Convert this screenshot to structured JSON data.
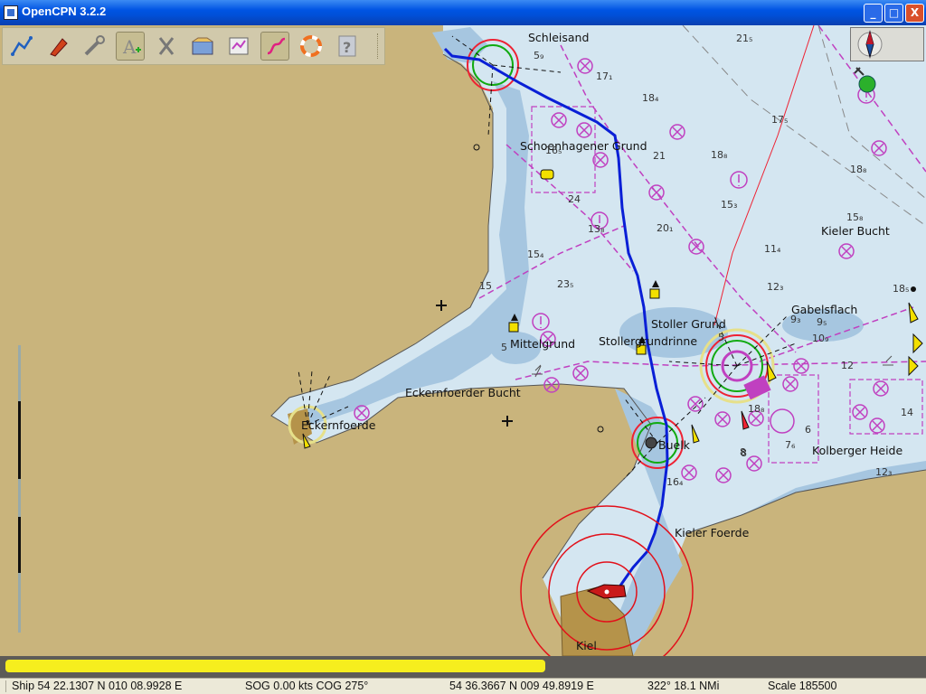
{
  "window": {
    "title": "OpenCPN 3.2.2",
    "min_label": "_",
    "max_label": "□",
    "close_label": "X"
  },
  "toolbar": {
    "buttons": [
      {
        "name": "route-icon",
        "tip": "Create Route"
      },
      {
        "name": "ownship-icon",
        "tip": "Auto Follow"
      },
      {
        "name": "settings-icon",
        "tip": "Toolbox"
      },
      {
        "name": "text-icon",
        "tip": "Show ENC Text"
      },
      {
        "name": "anchor-icon",
        "tip": "Anchor"
      },
      {
        "name": "tides-icon",
        "tip": "Tides"
      },
      {
        "name": "route-manager-icon",
        "tip": "Route Manager"
      },
      {
        "name": "track-icon",
        "tip": "Track"
      },
      {
        "name": "mob-icon",
        "tip": "Man Overboard"
      },
      {
        "name": "help-icon",
        "tip": "Help"
      }
    ]
  },
  "chart": {
    "place_labels": [
      {
        "key": "schleisand",
        "text": "Schleisand"
      },
      {
        "key": "schoenhagener",
        "text": "Schoenhagener Grund"
      },
      {
        "key": "kieler_bucht",
        "text": "Kieler Bucht"
      },
      {
        "key": "gabelsflach",
        "text": "Gabelsflach"
      },
      {
        "key": "stoller_grund",
        "text": "Stoller Grund"
      },
      {
        "key": "stollergrundrinne",
        "text": "Stollergrundrinne"
      },
      {
        "key": "mittelgrund",
        "text": "Mittelgrund"
      },
      {
        "key": "eckernfoerder_bucht",
        "text": "Eckernfoerder Bucht"
      },
      {
        "key": "eckernfoerde",
        "text": "Eckernfoerde"
      },
      {
        "key": "buelk",
        "text": "Buelk"
      },
      {
        "key": "kolberger_heide",
        "text": "Kolberger Heide"
      },
      {
        "key": "kieler_foerde",
        "text": "Kieler Foerde"
      },
      {
        "key": "kiel",
        "text": "Kiel"
      }
    ],
    "soundings": [
      "21₅",
      "17₁",
      "18₄",
      "17₅",
      "16₅",
      "21",
      "18₈",
      "18₈",
      "24",
      "15₃",
      "15₈",
      "20₁",
      "13₈",
      "11₄",
      "15₄",
      "23₅",
      "12₃",
      "18₅",
      "9₃",
      "9₅",
      "10₉",
      "12",
      "14",
      "8",
      "16₄",
      "7₆",
      "6",
      "5",
      "18₈",
      "8",
      "15",
      "12₃",
      "5₉",
      "5"
    ]
  },
  "progress": {
    "value_percent": 59
  },
  "status": {
    "ship": "Ship 54 22.1307 N   010 08.9928 E",
    "sog_cog": "SOG 0.00 kts  COG 275°",
    "cursor_pos": "54 36.3667 N   009 49.8919 E",
    "bearing_dist": "322°  18.1 NMi",
    "scale": "Scale 185500"
  },
  "colors": {
    "land": "#c9b47c",
    "shallow": "#a6c6e0",
    "water": "#d4e6f1",
    "route": "#0a1fd6",
    "magenta": "#c040c0"
  }
}
